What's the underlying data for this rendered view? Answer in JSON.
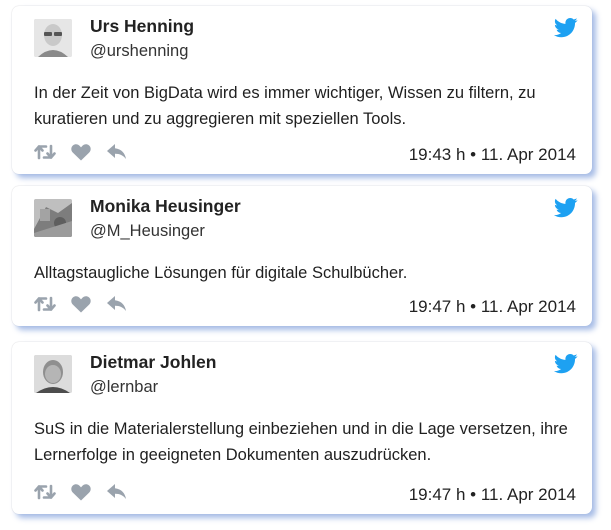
{
  "tweets": [
    {
      "display_name": "Urs Henning",
      "handle": "@urshenning",
      "text": "In der Zeit von BigData wird es immer wichtiger, Wissen zu filtern, zu kuratieren und zu aggregieren mit speziellen Tools.",
      "timestamp": "19:43 h • 11. Apr 2014"
    },
    {
      "display_name": "Monika Heusinger",
      "handle": "@M_Heusinger",
      "text": "Alltagstaugliche Lösungen für digitale Schulbücher.",
      "timestamp": "19:47 h • 11. Apr 2014"
    },
    {
      "display_name": "Dietmar Johlen",
      "handle": "@lernbar",
      "text": "SuS in die Materialerstellung einbeziehen und in die Lage versetzen, ihre Lernerfolge in geeigneten Dokumenten auszudrücken.",
      "timestamp": "19:47 h • 11. Apr 2014"
    }
  ],
  "icons": {
    "brand": "twitter-bird-icon",
    "actions": [
      "retweet-icon",
      "like-icon",
      "reply-icon"
    ]
  },
  "colors": {
    "twitter_blue": "#1da1f2",
    "action_gray": "#9aa3ad",
    "card_shadow": "#96b0e2"
  }
}
